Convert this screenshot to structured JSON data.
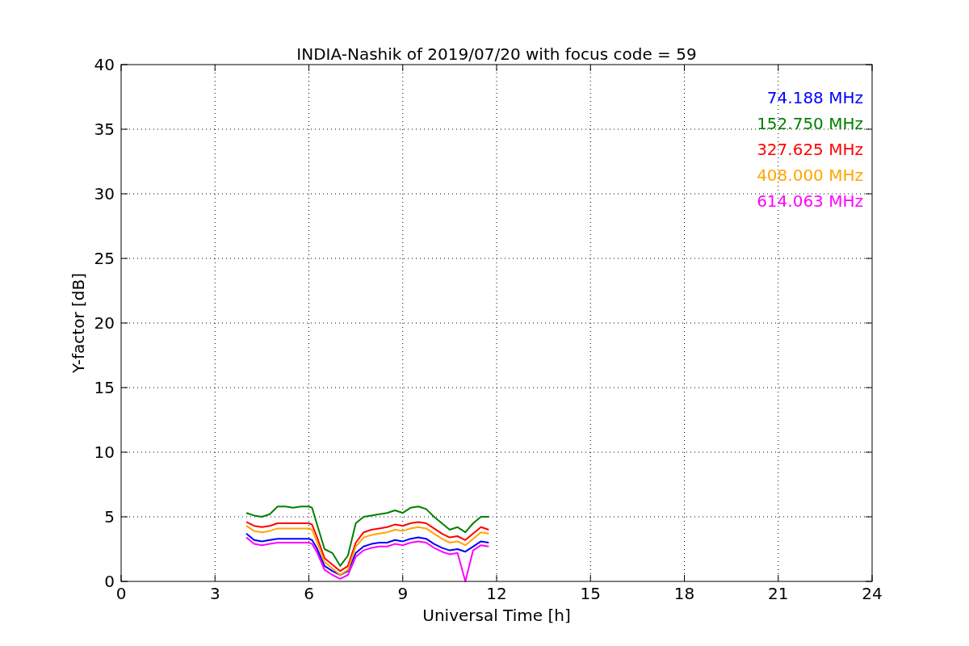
{
  "chart": {
    "chart_data": {
      "type": "line",
      "title": "INDIA-Nashik of 2019/07/20 with focus code = 59",
      "xlabel": "Universal Time [h]",
      "ylabel": "Y-factor [dB]",
      "x": [
        4,
        4.25,
        4.5,
        4.75,
        5,
        5.25,
        5.5,
        5.75,
        6,
        6.1,
        6.25,
        6.5,
        6.75,
        7,
        7.25,
        7.5,
        7.75,
        8,
        8.25,
        8.5,
        8.75,
        9,
        9.25,
        9.5,
        9.75,
        10,
        10.25,
        10.5,
        10.75,
        11,
        11.25,
        11.5,
        11.75
      ],
      "series": [
        {
          "name": "74.188 MHz",
          "color": "#0000ff",
          "values": [
            3.7,
            3.2,
            3.1,
            3.2,
            3.3,
            3.3,
            3.3,
            3.3,
            3.3,
            3.2,
            2.6,
            1.2,
            0.8,
            0.5,
            0.8,
            2.2,
            2.7,
            2.9,
            3.0,
            3.0,
            3.2,
            3.1,
            3.3,
            3.4,
            3.3,
            2.9,
            2.6,
            2.4,
            2.5,
            2.3,
            2.7,
            3.1,
            3.0
          ]
        },
        {
          "name": "152.750 MHz",
          "color": "#008000",
          "values": [
            5.3,
            5.1,
            5.0,
            5.2,
            5.8,
            5.8,
            5.7,
            5.8,
            5.8,
            5.7,
            4.5,
            2.5,
            2.2,
            1.2,
            2.0,
            4.5,
            5.0,
            5.1,
            5.2,
            5.3,
            5.5,
            5.3,
            5.7,
            5.8,
            5.6,
            5.0,
            4.5,
            4.0,
            4.2,
            3.8,
            4.5,
            5.0,
            5.0
          ]
        },
        {
          "name": "327.625 MHz",
          "color": "#ff0000",
          "values": [
            4.6,
            4.3,
            4.2,
            4.3,
            4.5,
            4.5,
            4.5,
            4.5,
            4.5,
            4.4,
            3.5,
            1.8,
            1.3,
            0.8,
            1.2,
            3.0,
            3.8,
            4.0,
            4.1,
            4.2,
            4.4,
            4.3,
            4.5,
            4.6,
            4.5,
            4.1,
            3.7,
            3.4,
            3.5,
            3.2,
            3.7,
            4.2,
            4.0
          ]
        },
        {
          "name": "408.000 MHz",
          "color": "#ffa500",
          "values": [
            4.3,
            3.9,
            3.8,
            3.9,
            4.1,
            4.1,
            4.1,
            4.1,
            4.1,
            4.0,
            3.1,
            1.5,
            1.0,
            0.5,
            0.9,
            2.7,
            3.4,
            3.6,
            3.7,
            3.8,
            4.0,
            3.9,
            4.1,
            4.2,
            4.1,
            3.7,
            3.3,
            3.0,
            3.1,
            2.8,
            3.3,
            3.8,
            3.7
          ]
        },
        {
          "name": "614.063 MHz",
          "color": "#ff00ff",
          "values": [
            3.4,
            2.9,
            2.8,
            2.9,
            3.0,
            3.0,
            3.0,
            3.0,
            3.0,
            2.9,
            2.3,
            0.9,
            0.5,
            0.2,
            0.5,
            1.9,
            2.4,
            2.6,
            2.7,
            2.7,
            2.9,
            2.8,
            3.0,
            3.1,
            3.0,
            2.6,
            2.3,
            2.1,
            2.2,
            0.0,
            2.4,
            2.8,
            2.7
          ]
        }
      ],
      "grid": true,
      "xlim": [
        0,
        24
      ],
      "ylim": [
        0,
        40
      ],
      "xticks": [
        0,
        3,
        6,
        9,
        12,
        15,
        18,
        21,
        24
      ],
      "yticks": [
        0,
        5,
        10,
        15,
        20,
        25,
        30,
        35,
        40
      ]
    }
  }
}
